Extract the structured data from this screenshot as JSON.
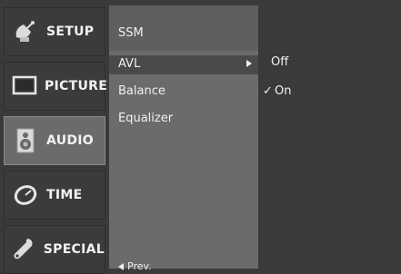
{
  "sidebar": {
    "tabs": [
      {
        "label": "SETUP",
        "icon": "satellite-dish-icon"
      },
      {
        "label": "PICTURE",
        "icon": "monitor-icon"
      },
      {
        "label": "AUDIO",
        "icon": "speaker-icon"
      },
      {
        "label": "TIME",
        "icon": "clock-icon"
      },
      {
        "label": "SPECIAL",
        "icon": "wrench-icon"
      }
    ],
    "active": "AUDIO"
  },
  "submenu": {
    "items": [
      "SSM",
      "AVL",
      "Balance",
      "Equalizer"
    ],
    "selected": "AVL",
    "prev_label": "Prev."
  },
  "options": {
    "items": [
      {
        "label": "Off",
        "checked": false
      },
      {
        "label": "On",
        "checked": true
      }
    ],
    "checkmark": "✓"
  },
  "colors": {
    "frame": "#3a3a3a",
    "submenu_bg": "#6b6b6b",
    "active_tab": "#6b6b6b",
    "text": "#f0f0f0"
  }
}
